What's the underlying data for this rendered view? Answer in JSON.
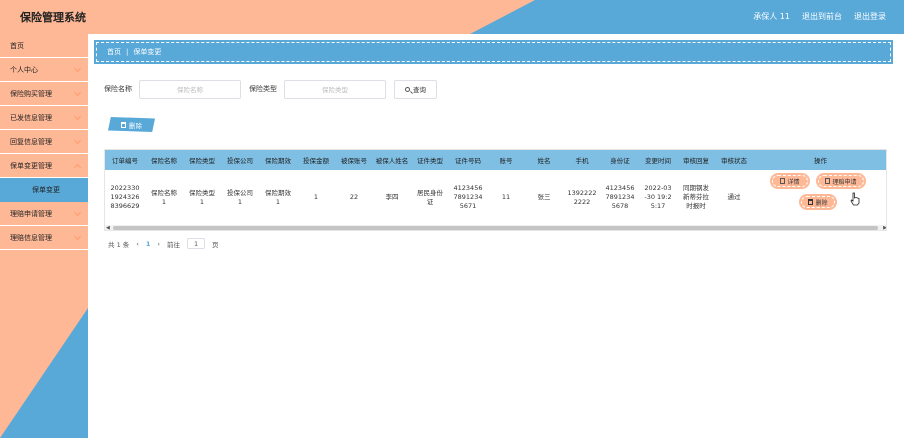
{
  "app": {
    "title": "保险管理系统"
  },
  "top_links": [
    "承保人 11",
    "退出到前台",
    "退出登录"
  ],
  "sidebar": {
    "items": [
      {
        "label": "首页",
        "has_chevron": false
      },
      {
        "label": "个人中心",
        "has_chevron": true
      },
      {
        "label": "保险购买管理",
        "has_chevron": true
      },
      {
        "label": "已发信息管理",
        "has_chevron": true
      },
      {
        "label": "回复信息管理",
        "has_chevron": true
      },
      {
        "label": "保单变更管理",
        "has_chevron": true
      }
    ],
    "active_sub": "保单变更",
    "items_after": [
      {
        "label": "理赔申请管理",
        "has_chevron": true
      },
      {
        "label": "理赔信息管理",
        "has_chevron": true
      }
    ]
  },
  "breadcrumb": {
    "home": "首页",
    "separator": "|",
    "current": "保单变更"
  },
  "search": {
    "name_label": "保险名称",
    "name_placeholder": "保险名称",
    "type_label": "保险类型",
    "type_placeholder": "保险类型",
    "query_button": "查询"
  },
  "toolbar": {
    "delete_label": "删除"
  },
  "table": {
    "headers": [
      "订单编号",
      "保险名称",
      "保险类型",
      "投保公司",
      "保险期效",
      "投保金额",
      "被保账号",
      "被保人姓名",
      "证件类型",
      "证件号码",
      "账号",
      "姓名",
      "手机",
      "身份证",
      "变更时间",
      "审核回复",
      "审核状态",
      "操作"
    ],
    "rows": [
      {
        "cells": [
          "2022330\n1924326\n8396629",
          "保险名称\n1",
          "保险类型\n1",
          "投保公司\n1",
          "保险期效\n1",
          "1",
          "22",
          "李四",
          "居民身份\n证",
          "4123456\n7891234\n5671",
          "11",
          "张三",
          "1392222\n2222",
          "4123456\n7891234\n5678",
          "2022-03\n-30 19:2\n5:17",
          "同期钢发\n新蒂芬拉\n时报时",
          "通过"
        ],
        "actions": {
          "detail": "详情",
          "claim": "理赔申请",
          "delete": "删除"
        }
      }
    ]
  },
  "pager": {
    "total": "共 1 条",
    "prev": "‹",
    "page": "1",
    "next": "›",
    "goto_label": "前往",
    "goto_value": "1",
    "page_suffix": "页"
  },
  "colors": {
    "salmon": "#ffb896",
    "blue": "#58a8d8",
    "header_blue": "#7fbfe4"
  }
}
